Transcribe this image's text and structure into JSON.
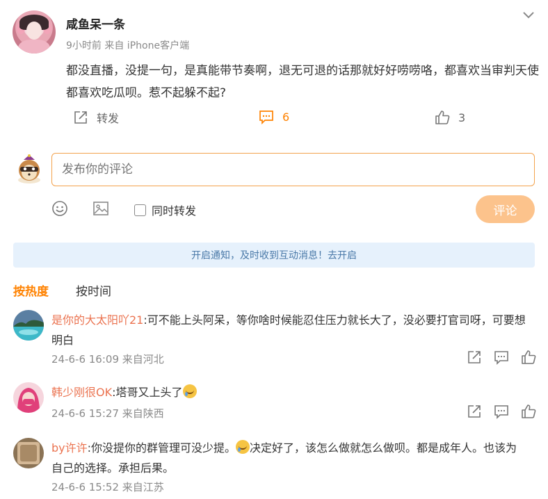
{
  "post": {
    "username": "咸鱼呆一条",
    "meta": "9小时前 来自 iPhone客户端",
    "text": "都没直播，没提一句，是真能带节奏啊，退无可退的话那就好好唠唠咯，都喜欢当审判天使都喜欢吃瓜呗。惹不起躲不起?",
    "repost_label": "转发",
    "comment_count": "6",
    "like_count": "3"
  },
  "composer": {
    "placeholder": "发布你的评论",
    "repost_checkbox_label": "同时转发",
    "submit_label": "评论"
  },
  "notice": "开启通知，及时收到互动消息！去开启",
  "sort": {
    "hot": "按热度",
    "time": "按时间"
  },
  "comments": [
    {
      "user": "是你的大太阳吖21",
      "text": ":可不能上头阿呆，等你啥时候能忍住压力就长大了，没必要打官司呀，可要想",
      "text2": "明白",
      "meta": "24-6-6 16:09 来自河北"
    },
    {
      "user": "韩少刚很OK",
      "text": ":塔哥又上头了",
      "meta": "24-6-6 15:27 来自陕西"
    },
    {
      "user": "by许许",
      "text": ":你没提你的群管理可没少提。",
      "text_b": "决定好了，该怎么做就怎么做呗。都是成年人。也该为",
      "text2": "自己的选择。承担后果。",
      "meta": "24-6-6 15:52 来自江苏"
    }
  ],
  "colors": {
    "accent": "#ff8200",
    "username_link": "#eb7350",
    "notice_bg": "#e6f1fc",
    "submit_disabled": "#fcc38c"
  },
  "icons": [
    "chevron-down-icon",
    "repost-icon",
    "comment-icon",
    "like-icon",
    "emoji-icon",
    "image-icon",
    "share-icon"
  ]
}
